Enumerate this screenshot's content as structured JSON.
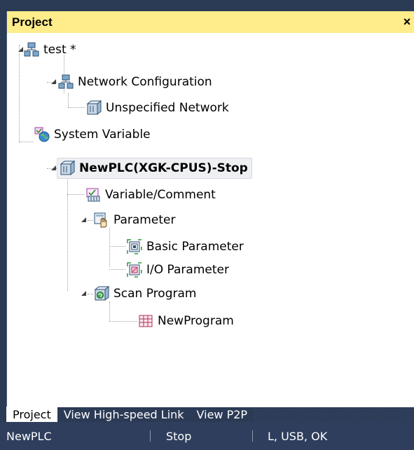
{
  "panel": {
    "title": "Project",
    "close": "×"
  },
  "tree": {
    "root": "test *",
    "network_config": "Network Configuration",
    "unspecified_network": "Unspecified Network",
    "system_variable": "System Variable",
    "plc": "NewPLC(XGK-CPUS)-Stop",
    "variable_comment": "Variable/Comment",
    "parameter": "Parameter",
    "basic_parameter": "Basic Parameter",
    "io_parameter": "I/O Parameter",
    "scan_program": "Scan Program",
    "new_program": "NewProgram"
  },
  "tabs": [
    "Project",
    "View High-speed Link",
    "View P2P"
  ],
  "status": {
    "plc": "NewPLC",
    "state": "Stop",
    "connection": "L, USB, OK"
  },
  "colors": {
    "title_bg": "#ffec8b",
    "chrome": "#2b3a55",
    "tree_lines": "#a0a0a0"
  }
}
